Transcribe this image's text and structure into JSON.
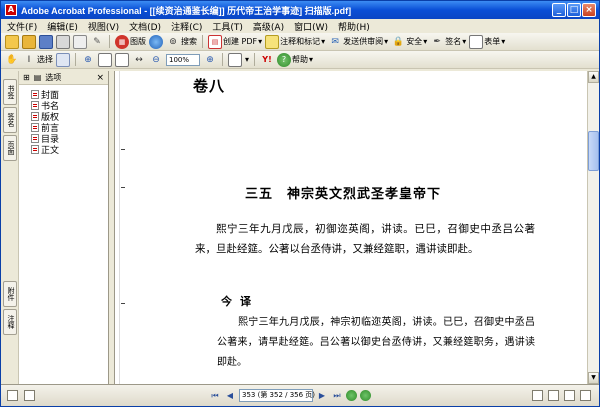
{
  "window": {
    "title": "Adobe Acrobat Professional - [[续资治通鉴长编]] 历代帝王治学事迹] 扫描版.pdf]",
    "buttons": [
      "_",
      "□",
      "×"
    ]
  },
  "menu": [
    "文件(F)",
    "编辑(E)",
    "视图(V)",
    "文档(D)",
    "注释(C)",
    "工具(T)",
    "高级(A)",
    "窗口(W)",
    "帮助(H)"
  ],
  "toolbar1": {
    "print_label": "图版",
    "search_label": "搜索",
    "create_pdf_label": "创建 PDF",
    "review_label": "注释和标记",
    "send_label": "发送供审阅",
    "secure_label": "安全",
    "sign_label": "签名",
    "forms_label": "表单"
  },
  "toolbar2": {
    "select_label": "选择",
    "zoom_value": "100%",
    "help_label": "帮助"
  },
  "nav_tabs": [
    "书签",
    "签名",
    "页面",
    "附件",
    "注释"
  ],
  "pane": {
    "options_label": "选项",
    "close": "×",
    "bookmarks": [
      "封面",
      "书名",
      "版权",
      "前言",
      "目录",
      "正文"
    ]
  },
  "document": {
    "juan": "卷八",
    "chapter": "三五　神宗英文烈武圣孝皇帝下",
    "para1": "熙宁三年九月戊辰，初御迩英阁，讲读。已巳，召御史中丞吕公著来，旦赴经筵。公著以台丞侍讲，又兼经筵职，遇讲读即赴。",
    "jinyi": "今译",
    "para2": "熙宁三年九月戊辰，神宗初临迩英阁，讲读。已巳，召御史中丞吕公著来，请早赴经筵。吕公著以御史台丞侍讲，又兼经筵职务，遇讲读即赴。"
  },
  "statusbar": {
    "page_display": "353 (第 352 / 356 页)"
  }
}
